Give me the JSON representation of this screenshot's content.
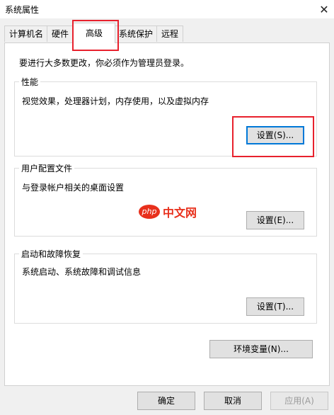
{
  "window": {
    "title": "系统属性",
    "close_label": "✕"
  },
  "tabs": [
    {
      "label": "计算机名"
    },
    {
      "label": "硬件"
    },
    {
      "label": "高级"
    },
    {
      "label": "系统保护"
    },
    {
      "label": "远程"
    }
  ],
  "notice": "要进行大多数更改，你必须作为管理员登录。",
  "performance": {
    "title": "性能",
    "description": "视觉效果，处理器计划，内存使用，以及虚拟内存",
    "settings_button": "设置(S)..."
  },
  "user_profiles": {
    "title": "用户配置文件",
    "description": "与登录帐户相关的桌面设置",
    "settings_button": "设置(E)..."
  },
  "startup_recovery": {
    "title": "启动和故障恢复",
    "description": "系统启动、系统故障和调试信息",
    "settings_button": "设置(T)..."
  },
  "env_button": "环境变量(N)...",
  "footer": {
    "ok": "确定",
    "cancel": "取消",
    "apply": "应用(A)"
  },
  "watermark": {
    "logo": "php",
    "text": "中文网"
  },
  "colors": {
    "highlight": "#e8212d",
    "focus": "#0078d7"
  }
}
